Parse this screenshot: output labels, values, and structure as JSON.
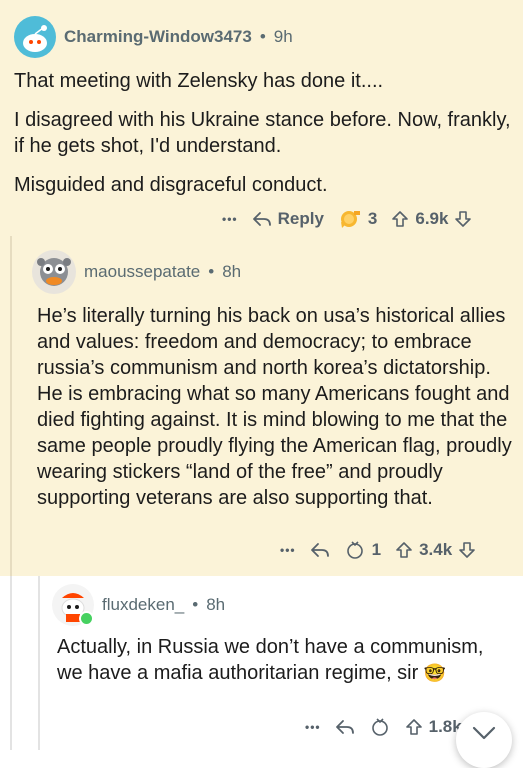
{
  "comment1": {
    "username": "Charming-Window3473",
    "separator": "•",
    "time": "9h",
    "paragraphs": [
      "That meeting with Zelensky has done it....",
      "I disagreed with his Ukraine stance before. Now, frankly, if he gets shot, I'd understand.",
      "Misguided and disgraceful conduct."
    ],
    "more": "•••",
    "reply_label": "Reply",
    "award_count": "3",
    "score": "6.9k"
  },
  "comment2": {
    "username": "maoussepatate",
    "separator": "•",
    "time": "8h",
    "text": "He’s literally turning his back on usa’s historical allies and values: freedom and democracy; to embrace russia’s communism and north korea’s dictatorship. He is embracing what so many Americans fought and died fighting against. It is mind blowing to me that the same people proudly flying the American flag, proudly wearing stickers “land of the free” and proudly supporting veterans are also supporting that.",
    "more": "•••",
    "award_count": "1",
    "score": "3.4k"
  },
  "comment3": {
    "username": "fluxdeken_",
    "separator": "•",
    "time": "8h",
    "text": "Actually, in Russia we don’t have a communism, we have a mafia authoritarian regime, sir",
    "emoji": "🤓",
    "more": "•••",
    "score": "1.8k"
  },
  "colors": {
    "highlight_bg": "#fbf3d8",
    "meta_text": "#5a6b72",
    "online_dot": "#46d160"
  }
}
